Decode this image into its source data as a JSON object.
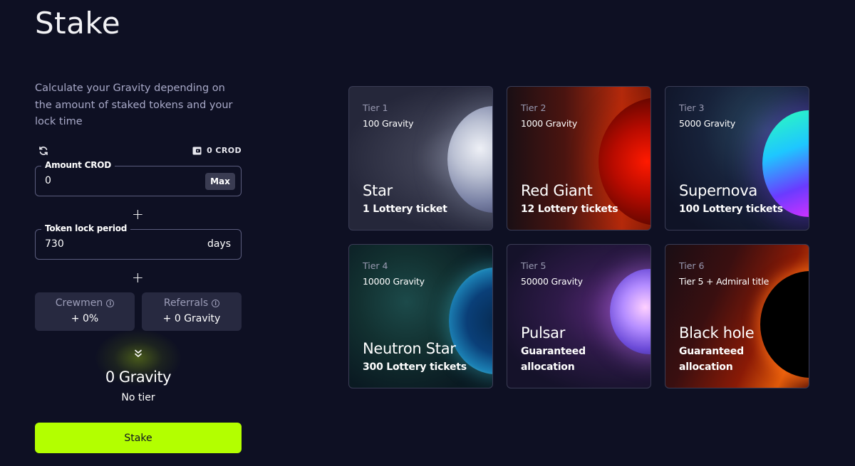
{
  "page": {
    "title": "Stake",
    "intro": "Calculate your Gravity depending on the amount of staked tokens and your lock time"
  },
  "balance": {
    "label": "0 CROD"
  },
  "amount_field": {
    "label": "Amount CROD",
    "value": "0",
    "max_label": "Max"
  },
  "lock_field": {
    "label": "Token lock period",
    "value": "730",
    "unit": "days"
  },
  "plus_symbol": "+",
  "stats": {
    "crewmen": {
      "label": "Crewmen",
      "value": "+ 0%"
    },
    "referrals": {
      "label": "Referrals",
      "value": "+ 0 Gravity"
    }
  },
  "result": {
    "gravity": "0 Gravity",
    "tier": "No tier"
  },
  "stake_button": {
    "label": "Stake"
  },
  "tiers": [
    {
      "tier": "Tier 1",
      "gravity": "100 Gravity",
      "name": "Star",
      "reward": "1 Lottery ticket"
    },
    {
      "tier": "Tier 2",
      "gravity": "1000 Gravity",
      "name": "Red Giant",
      "reward": "12 Lottery tickets"
    },
    {
      "tier": "Tier 3",
      "gravity": "5000 Gravity",
      "name": "Supernova",
      "reward": "100 Lottery tickets"
    },
    {
      "tier": "Tier 4",
      "gravity": "10000 Gravity",
      "name": "Neutron Star",
      "reward": "300 Lottery tickets"
    },
    {
      "tier": "Tier 5",
      "gravity": "50000 Gravity",
      "name": "Pulsar",
      "reward": "Guaranteed allocation"
    },
    {
      "tier": "Tier 6",
      "gravity": "Tier 5 + Admiral title",
      "name": "Black hole",
      "reward": "Guaranteed allocation"
    }
  ],
  "colors": {
    "background": "#0e1023",
    "accent": "#b3ff00",
    "field_border": "#5b5d7e",
    "stat_bg": "#272940"
  },
  "icons": {
    "refresh": "refresh-icon",
    "wallet": "wallet-icon",
    "info": "info-icon",
    "chevrons": "chevrons-down-icon"
  }
}
